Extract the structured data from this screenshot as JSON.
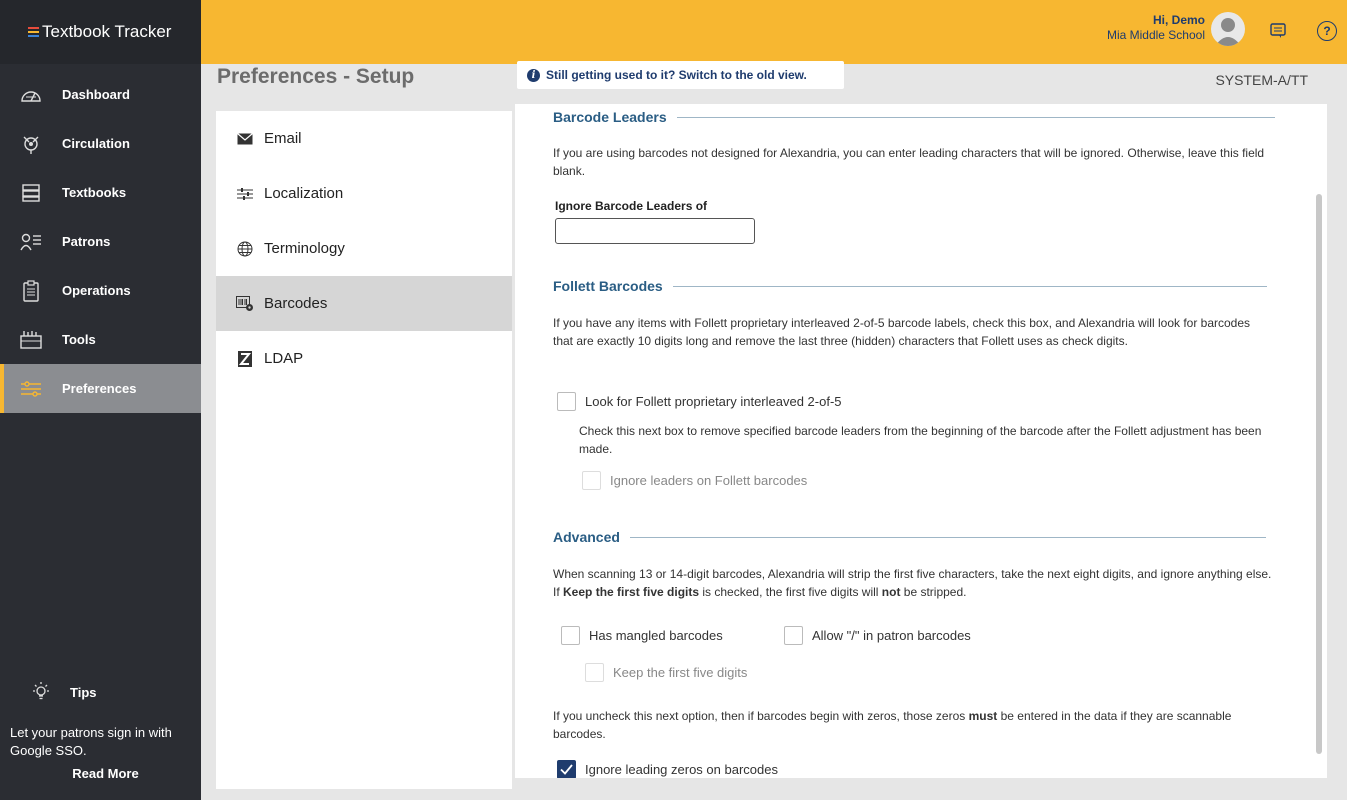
{
  "app": {
    "title": "Textbook Tracker",
    "logo_colors": [
      "#e74c3c",
      "#f7b731",
      "#3b82d6"
    ]
  },
  "sidebar": {
    "items": [
      {
        "label": "Dashboard",
        "icon": "dashboard-gauge-icon"
      },
      {
        "label": "Circulation",
        "icon": "circulation-icon"
      },
      {
        "label": "Textbooks",
        "icon": "textbooks-icon"
      },
      {
        "label": "Patrons",
        "icon": "patrons-icon"
      },
      {
        "label": "Operations",
        "icon": "operations-clipboard-icon"
      },
      {
        "label": "Tools",
        "icon": "tools-icon"
      },
      {
        "label": "Preferences",
        "icon": "preferences-sliders-icon",
        "active": true
      }
    ],
    "tips": {
      "title": "Tips",
      "text": "Let your patrons sign in with Google SSO.",
      "link": "Read More"
    }
  },
  "header": {
    "greeting": "Hi, Demo",
    "school": "Mia Middle School",
    "accent": "#f7b731",
    "help": "?"
  },
  "page": {
    "title": "Preferences - Setup",
    "old_view": "Still getting used to it? Switch to the old view.",
    "system": "SYSTEM-A/TT"
  },
  "subnav": {
    "items": [
      {
        "label": "Email",
        "icon": "envelope-icon"
      },
      {
        "label": "Localization",
        "icon": "sliders-icon"
      },
      {
        "label": "Terminology",
        "icon": "globe-icon"
      },
      {
        "label": "Barcodes",
        "icon": "barcode-gear-icon",
        "active": true
      },
      {
        "label": "LDAP",
        "icon": "ldap-icon"
      }
    ]
  },
  "content": {
    "barcode_leaders": {
      "heading": "Barcode Leaders",
      "desc": "If you are using barcodes not designed for Alexandria, you can enter leading characters that will be ignored. Otherwise, leave this field blank.",
      "field_label": "Ignore Barcode Leaders of",
      "field_value": ""
    },
    "follett": {
      "heading": "Follett Barcodes",
      "desc": "If you have any items with Follett proprietary interleaved 2-of-5 barcode labels, check this box, and Alexandria will look for barcodes that are exactly 10 digits long and remove the last three (hidden) characters that Follett uses as check digits.",
      "cb1": "Look for Follett proprietary interleaved 2-of-5",
      "sub_desc": "Check this next box to remove specified barcode leaders from the beginning of the barcode after the Follett adjustment has been made.",
      "cb2": "Ignore leaders on Follett barcodes"
    },
    "advanced": {
      "heading": "Advanced",
      "desc_a": "When scanning 13 or 14-digit barcodes, Alexandria will strip the first five characters, take the next eight digits, and ignore anything else. If ",
      "desc_b": "Keep the first five digits",
      "desc_c": " is checked, the first five digits will ",
      "desc_d": "not",
      "desc_e": " be stripped.",
      "cb_mangled": "Has mangled barcodes",
      "cb_slash": "Allow \"/\" in patron barcodes",
      "cb_keep": "Keep the first five digits",
      "zeros_a": "If you uncheck this next option, then if barcodes begin with zeros, those zeros ",
      "zeros_b": "must",
      "zeros_c": " be entered in the data if they are scannable barcodes.",
      "cb_zeros": "Ignore leading zeros on barcodes",
      "cb_zeros_checked": true
    }
  }
}
